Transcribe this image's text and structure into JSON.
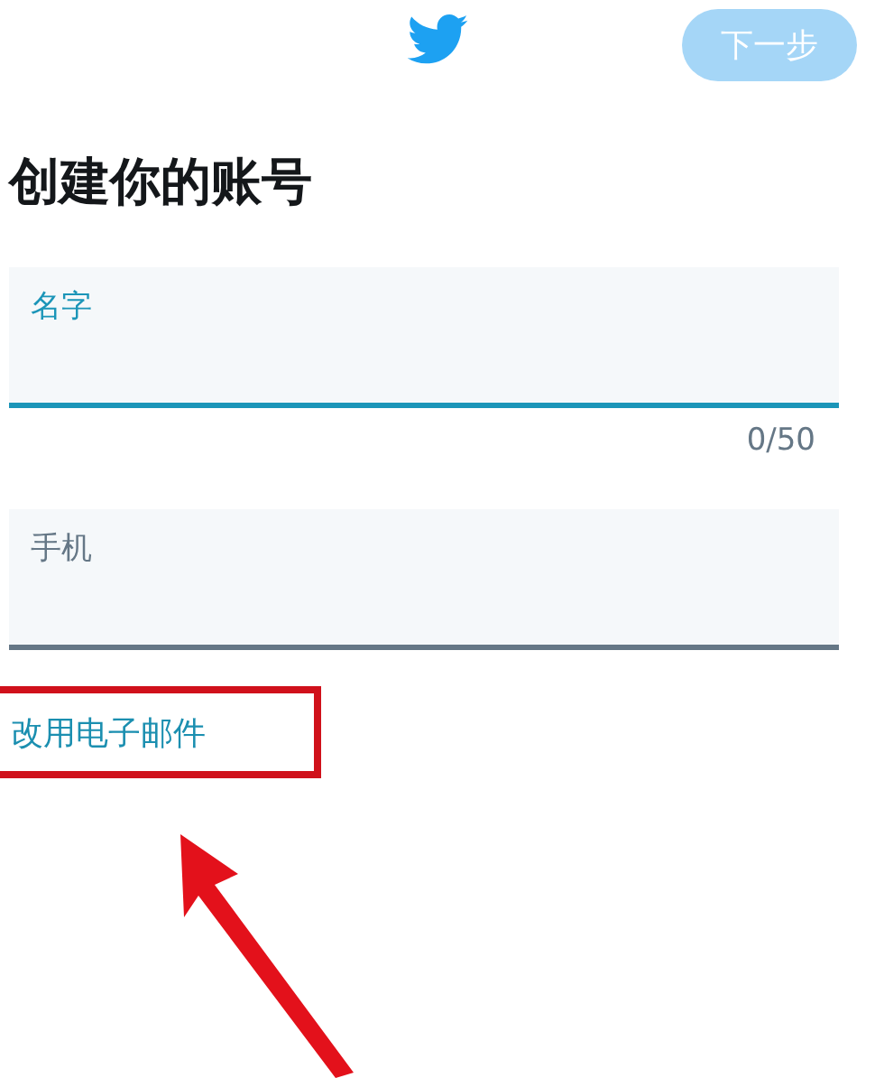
{
  "header": {
    "next_button": {
      "label": "下一步",
      "disabled": true
    }
  },
  "title": "创建你的账号",
  "fields": [
    {
      "label": "名字",
      "focused": true,
      "counter": "0/50"
    },
    {
      "label": "手机",
      "focused": false
    }
  ],
  "switch_link": "改用电子邮件"
}
